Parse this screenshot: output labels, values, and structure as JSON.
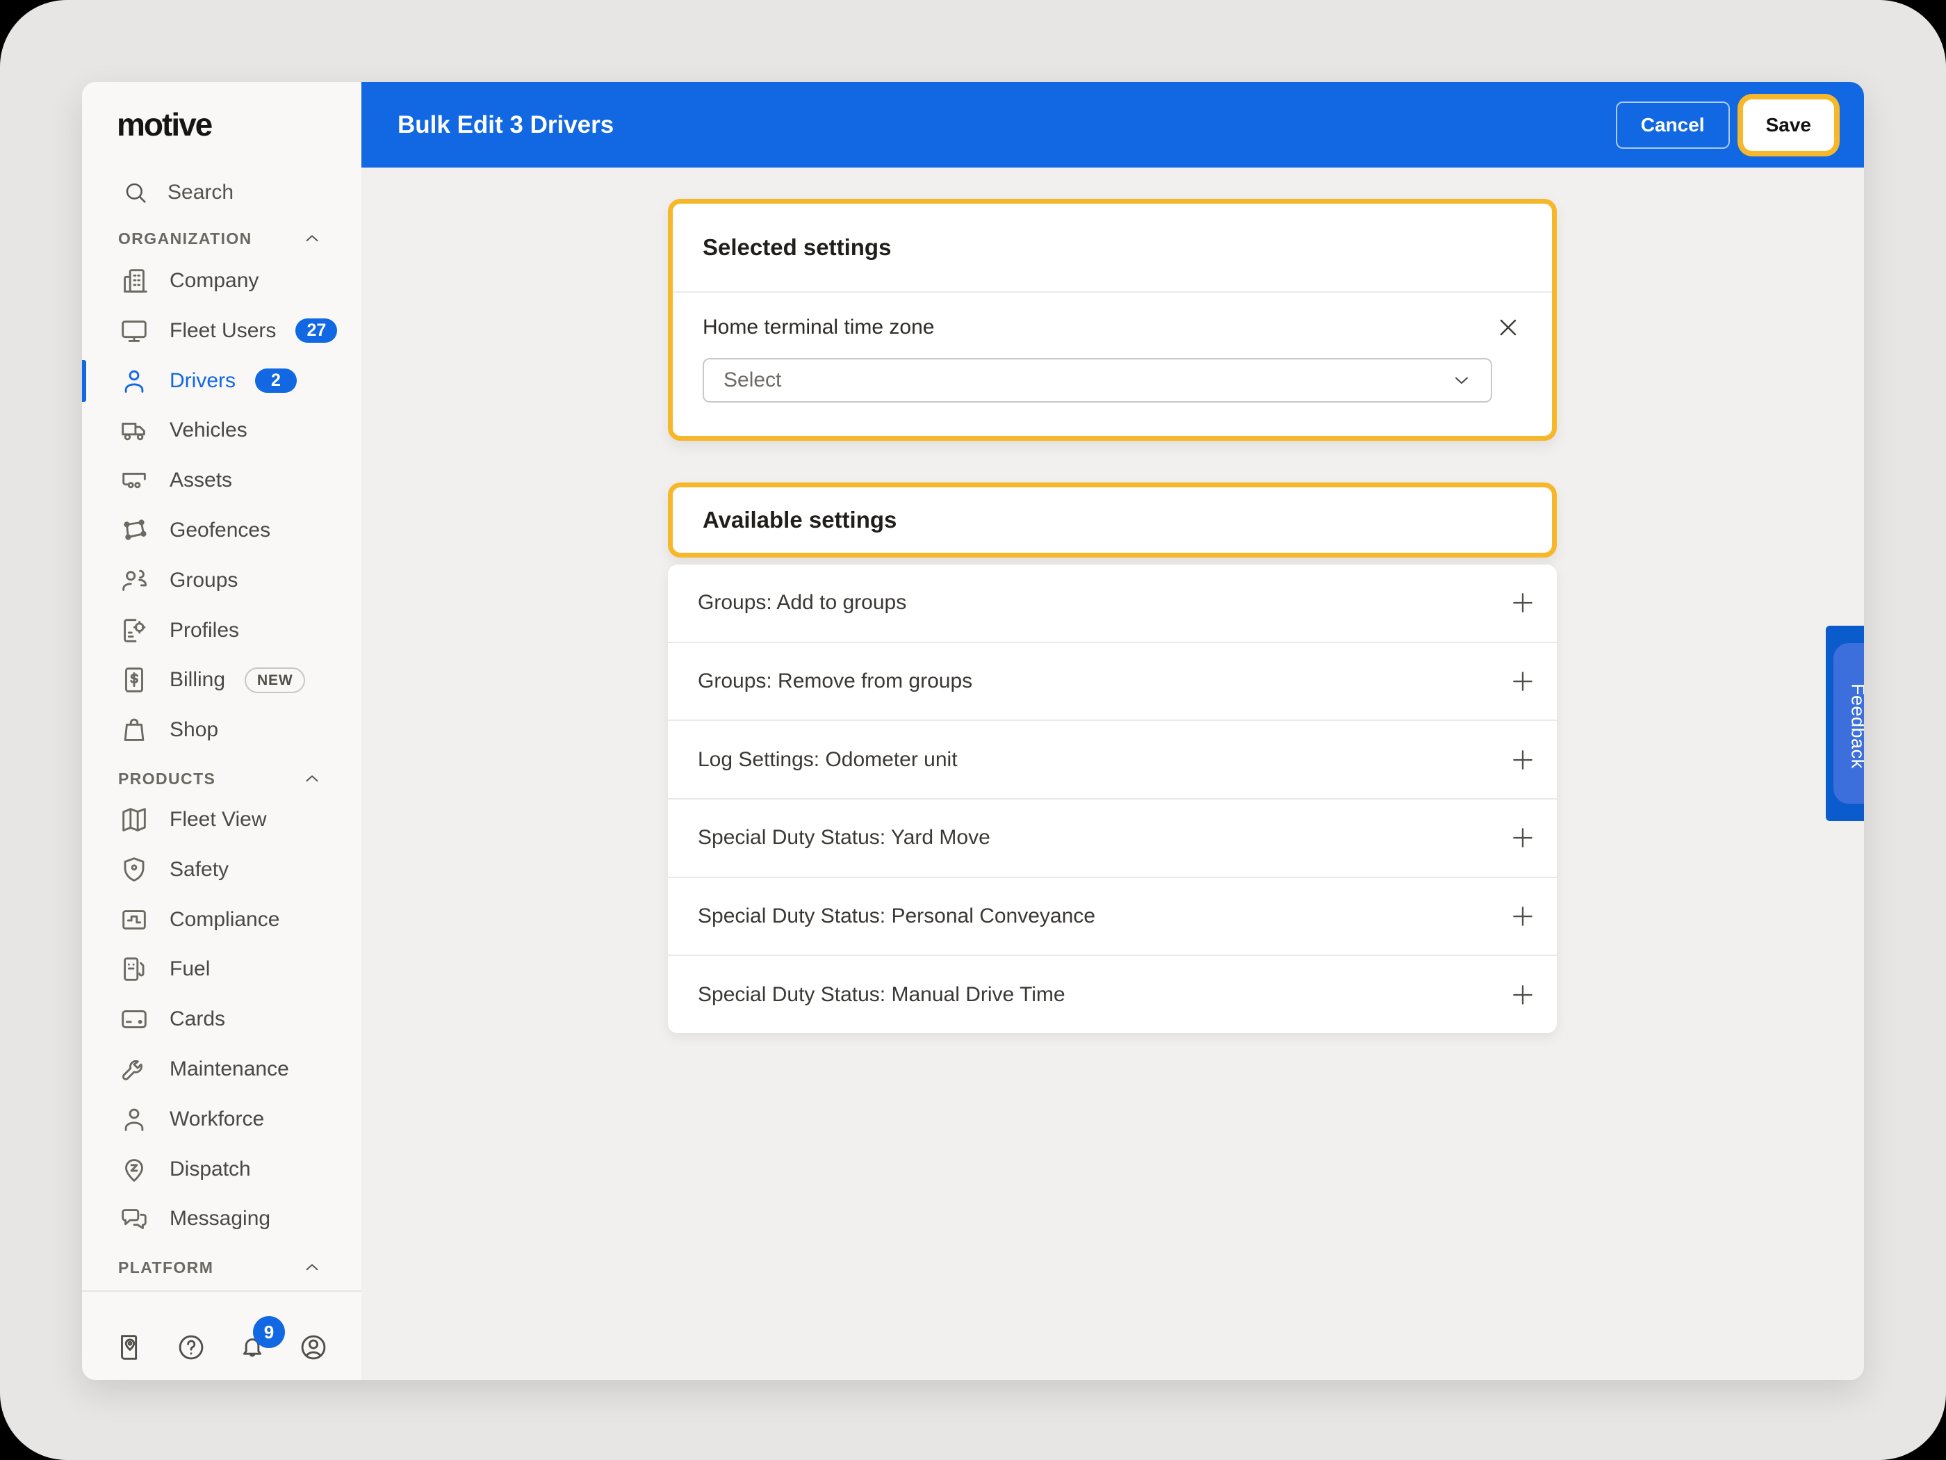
{
  "header": {
    "title": "Bulk Edit 3 Drivers",
    "cancel_label": "Cancel",
    "save_label": "Save"
  },
  "sidebar": {
    "logo_text": "motive",
    "search_label": "Search",
    "sections": [
      {
        "label": "ORGANIZATION",
        "items": [
          {
            "label": "Company",
            "icon": "company"
          },
          {
            "label": "Fleet Users",
            "icon": "monitor",
            "badge": "27"
          },
          {
            "label": "Drivers",
            "icon": "person",
            "badge": "2",
            "active": true
          },
          {
            "label": "Vehicles",
            "icon": "truck"
          },
          {
            "label": "Assets",
            "icon": "trailer"
          },
          {
            "label": "Geofences",
            "icon": "geofence"
          },
          {
            "label": "Groups",
            "icon": "groups"
          },
          {
            "label": "Profiles",
            "icon": "profile-doc"
          },
          {
            "label": "Billing",
            "icon": "billing-doc",
            "tag": "NEW"
          },
          {
            "label": "Shop",
            "icon": "shopping-bag"
          }
        ]
      },
      {
        "label": "PRODUCTS",
        "items": [
          {
            "label": "Fleet View",
            "icon": "map"
          },
          {
            "label": "Safety",
            "icon": "shield"
          },
          {
            "label": "Compliance",
            "icon": "compliance"
          },
          {
            "label": "Fuel",
            "icon": "fuel-pump"
          },
          {
            "label": "Cards",
            "icon": "credit-card"
          },
          {
            "label": "Maintenance",
            "icon": "wrench"
          },
          {
            "label": "Workforce",
            "icon": "person"
          },
          {
            "label": "Dispatch",
            "icon": "dispatch-pin"
          },
          {
            "label": "Messaging",
            "icon": "chat"
          }
        ]
      },
      {
        "label": "PLATFORM",
        "items": []
      }
    ],
    "footer_icons": [
      {
        "name": "guide",
        "icon": "guide"
      },
      {
        "name": "help",
        "icon": "help"
      },
      {
        "name": "notifications",
        "icon": "bell",
        "badge": "9"
      },
      {
        "name": "account",
        "icon": "account"
      }
    ]
  },
  "content": {
    "selected_settings": {
      "title": "Selected settings",
      "field_label": "Home terminal time zone",
      "select_placeholder": "Select"
    },
    "available_settings": {
      "title": "Available settings",
      "items": [
        "Groups: Add to groups",
        "Groups: Remove from groups",
        "Log Settings: Odometer unit",
        "Special Duty Status: Yard Move",
        "Special Duty Status: Personal Conveyance",
        "Special Duty Status: Manual Drive Time"
      ]
    }
  },
  "feedback_label": "Feedback",
  "colors": {
    "brand_blue": "#1168E2",
    "badge_blue": "#1168E2",
    "accent_yellow": "#F7B72A",
    "feedback_outer": "#0A5BCB",
    "feedback_inner": "#3D6FDC"
  }
}
